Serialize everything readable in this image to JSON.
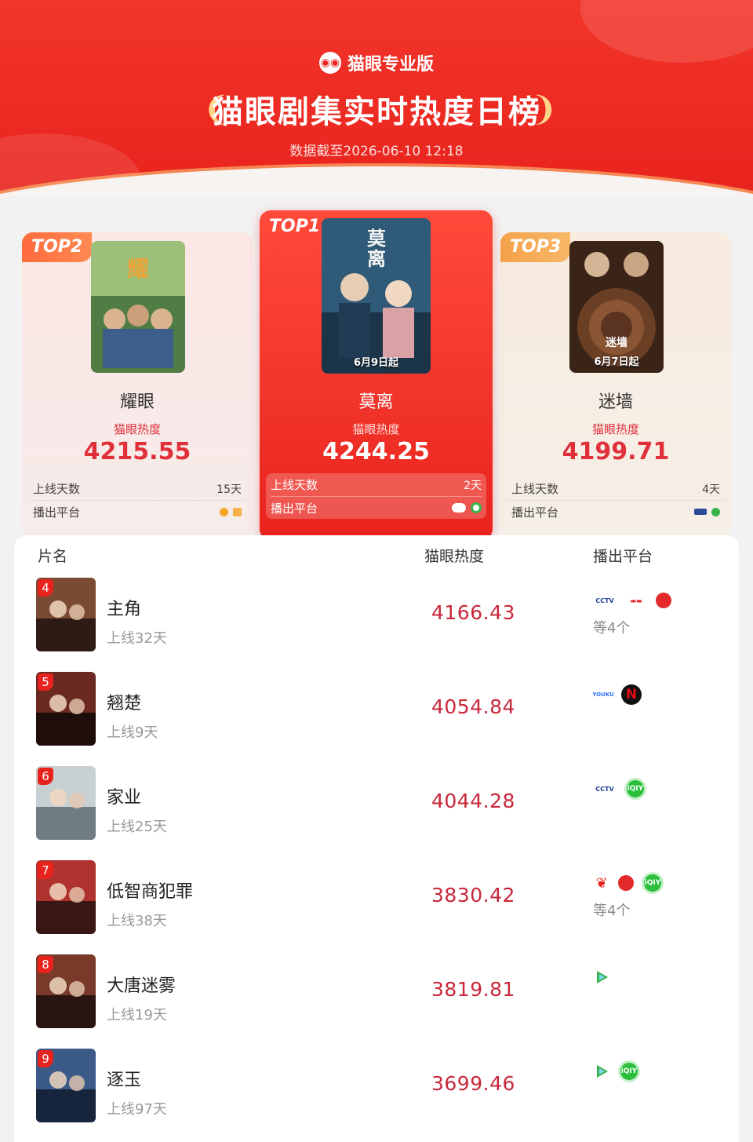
{
  "header": {
    "brand": "猫眼专业版",
    "title": "猫眼剧集实时热度日榜",
    "timestamp": "数据截至2026-06-10 12:18"
  },
  "labels": {
    "heat_label": "猫眼热度",
    "days_label": "上线天数",
    "platform_label": "播出平台"
  },
  "top": [
    {
      "rank_tag": "TOP1",
      "name": "莫离",
      "heat": "4244.25",
      "days": "2天",
      "poster_text": "6月9日起",
      "poster_title": "莫离",
      "colors": [
        "#3d6b8a",
        "#1c2e40"
      ]
    },
    {
      "rank_tag": "TOP2",
      "name": "耀眼",
      "heat": "4215.55",
      "days": "15天",
      "poster_text": "",
      "poster_title": "耀眼",
      "colors": [
        "#8fb36d",
        "#3f6e3c"
      ]
    },
    {
      "rank_tag": "TOP3",
      "name": "迷墙",
      "heat": "4199.71",
      "days": "4天",
      "poster_text": "6月7日起",
      "poster_title": "迷墙",
      "colors": [
        "#7a4a2e",
        "#2a1a12"
      ]
    }
  ],
  "list": {
    "headers": {
      "name": "片名",
      "heat": "猫眼热度",
      "platform": "播出平台"
    },
    "rows": [
      {
        "rank": "4",
        "name": "主角",
        "days": "上线32天",
        "heat": "4166.43",
        "more": "等4个",
        "platforms": [
          "cctv-icon",
          "bestv-icon",
          "red-circle-icon"
        ],
        "colors": [
          "#7a4a32",
          "#2e1c14"
        ]
      },
      {
        "rank": "5",
        "name": "翘楚",
        "days": "上线9天",
        "heat": "4054.84",
        "more": "",
        "platforms": [
          "youku-icon",
          "netflix-icon"
        ],
        "colors": [
          "#6a2a22",
          "#1e0d0a"
        ]
      },
      {
        "rank": "6",
        "name": "家业",
        "days": "上线25天",
        "heat": "4044.28",
        "more": "",
        "platforms": [
          "cctv-icon",
          "iqiyi-icon"
        ],
        "colors": [
          "#c9d0d4",
          "#6f7c84"
        ]
      },
      {
        "rank": "7",
        "name": "低智商犯罪",
        "days": "上线38天",
        "heat": "3830.42",
        "more": "等4个",
        "platforms": [
          "mango-icon",
          "red-circle-icon",
          "iqiyi-icon"
        ],
        "colors": [
          "#b0322e",
          "#3a1714"
        ]
      },
      {
        "rank": "8",
        "name": "大唐迷雾",
        "days": "上线19天",
        "heat": "3819.81",
        "more": "",
        "platforms": [
          "tencent-icon"
        ],
        "colors": [
          "#7a3a2a",
          "#2b1510"
        ]
      },
      {
        "rank": "9",
        "name": "逐玉",
        "days": "上线97天",
        "heat": "3699.46",
        "more": "",
        "platforms": [
          "tencent-icon",
          "iqiyi-icon"
        ],
        "colors": [
          "#3b5a88",
          "#16243c"
        ]
      }
    ]
  },
  "platform_text": {
    "cctv": "CCTV",
    "netflix": "N",
    "youku": "YOUKU",
    "iqiyi": "iQIY",
    "mango": "❦"
  },
  "colors": {
    "accent": "#e8231d",
    "heat_text": "#c8283a",
    "gold": "#ffd58a"
  }
}
